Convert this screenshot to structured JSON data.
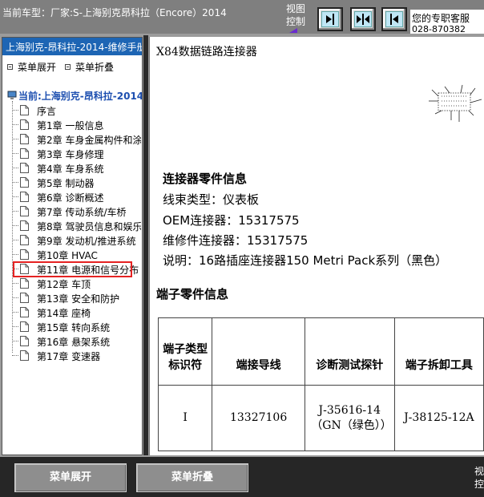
{
  "topbar": {
    "title": "当前车型：厂家:S-上海别克昂科拉（Encore）2014",
    "view_control_line1": "视图",
    "view_control_line2": "控制",
    "service_line1": "您的专职客服",
    "service_line2": "028-870382"
  },
  "sidebar": {
    "header": "上海别克-昂科拉-2014-维修手册",
    "expand_label": "菜单展开",
    "collapse_label": "菜单折叠",
    "root_label": "当前:上海别克-昂科拉-2014-",
    "items": [
      {
        "label": "序言"
      },
      {
        "label": "第1章 一般信息"
      },
      {
        "label": "第2章 车身金属构件和涂"
      },
      {
        "label": "第3章 车身修理"
      },
      {
        "label": "第4章 车身系统"
      },
      {
        "label": "第5章 制动器"
      },
      {
        "label": "第6章 诊断概述"
      },
      {
        "label": "第7章 传动系统/车桥"
      },
      {
        "label": "第8章 驾驶员信息和娱乐"
      },
      {
        "label": "第9章 发动机/推进系统"
      },
      {
        "label": "第10章 HVAC"
      },
      {
        "label": "第11章 电源和信号分布"
      },
      {
        "label": "第12章 车顶"
      },
      {
        "label": "第13章 安全和防护"
      },
      {
        "label": "第14章 座椅"
      },
      {
        "label": "第15章 转向系统"
      },
      {
        "label": "第16章 悬架系统"
      },
      {
        "label": "第17章 变速器"
      }
    ],
    "selected_index": 11
  },
  "content": {
    "doc_title": "X84数据链路连接器",
    "section1_title": "连接器零件信息",
    "info": [
      "线束类型：仪表板",
      "OEM连接器：15317575",
      "维修件连接器：15317575",
      "说明：16路插座连接器150 Metri Pack系列（黑色）"
    ],
    "section2_title": "端子零件信息",
    "table": {
      "headers": [
        "端子类型标识符",
        "端接导线",
        "诊断测试探针",
        "端子拆卸工具"
      ],
      "row": [
        "I",
        "13327106",
        "J-35616-14（GN（绿色））",
        "J-38125-12A"
      ]
    }
  },
  "bottombar": {
    "expand_label": "菜单展开",
    "collapse_label": "菜单折叠",
    "view_control_line1": "视",
    "view_control_line2": "控"
  },
  "colors": {
    "sidebar_header": "#1d65b4",
    "selection_border": "#e52222",
    "topbar_bg": "#7f7f7f",
    "bottombar_bg": "#262626"
  }
}
